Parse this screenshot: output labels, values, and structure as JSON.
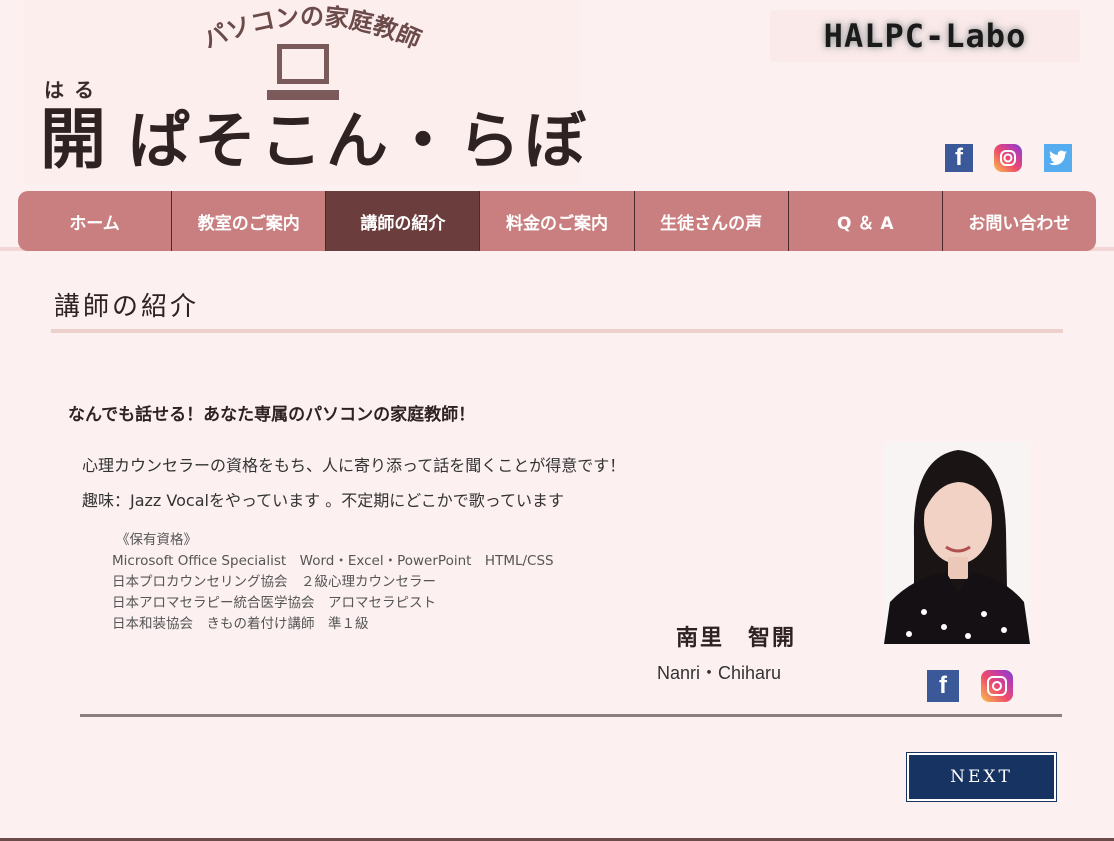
{
  "logo": {
    "arc_text": "パソコンの家庭教師",
    "furigana": "はる",
    "kanji": "開",
    "main_text": "ぱそこん・らぼ"
  },
  "brand_badge": "HALPC-Labo",
  "nav": {
    "items": [
      {
        "label": "ホーム"
      },
      {
        "label": "教室のご案内"
      },
      {
        "label": "講師の紹介"
      },
      {
        "label": "料金のご案内"
      },
      {
        "label": "生徒さんの声"
      },
      {
        "label": "Q ＆ A"
      },
      {
        "label": "お問い合わせ"
      }
    ],
    "active_index": 2
  },
  "page_title": "講師の紹介",
  "profile": {
    "headline": "なんでも話せる！あなた専属のパソコンの家庭教師！",
    "intro": "心理カウンセラーの資格をもち、人に寄り添って話を聞くことが得意です！",
    "hobby": "趣味：Jazz Vocalをやっています 。不定期にどこかで歌っています",
    "qualifications_heading": "《保有資格》",
    "qualifications": [
      "Microsoft Office Specialist　Word・Excel・PowerPoint　HTML/CSS",
      "日本プロカウンセリング協会　２級心理カウンセラー",
      "日本アロマセラピー統合医学協会　アロマセラピスト",
      "日本和装協会　きもの着付け講師　準１級"
    ],
    "name_jp": "南里　智開",
    "name_en": "Nanri・Chiharu"
  },
  "next_button": "NEXT",
  "colors": {
    "background": "#fdf0f0",
    "nav": "#c97f7f",
    "nav_active": "#6b3d3d",
    "next_button": "#163361"
  },
  "icons": [
    "laptop-icon",
    "facebook-icon",
    "instagram-icon",
    "twitter-icon"
  ]
}
